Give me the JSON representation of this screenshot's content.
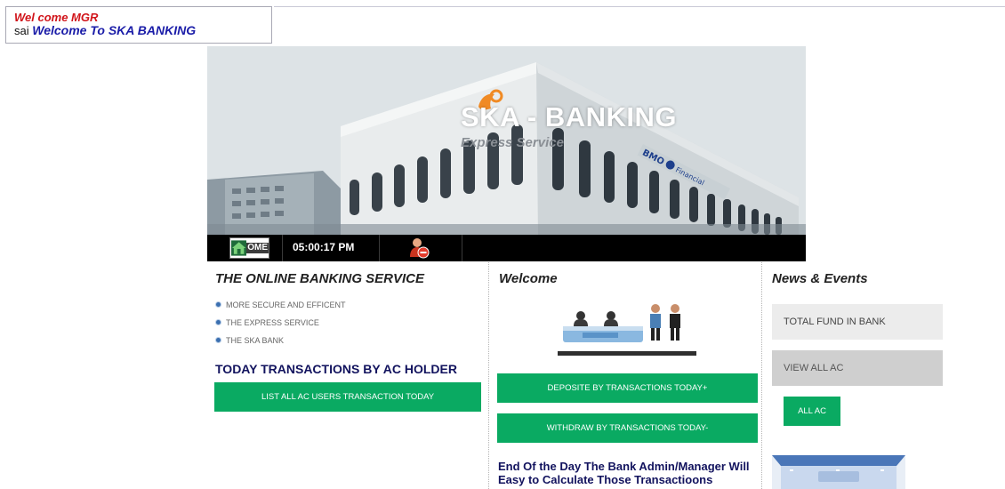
{
  "header": {
    "welcome_role": "Wel come MGR",
    "user_name": "sai",
    "welcome_message": "Welcome To SKA BANKING"
  },
  "banner": {
    "title": "SKA - BANKING",
    "subtitle": "Express Service"
  },
  "navbar": {
    "home_label": "OME",
    "clock": "05:00:17 PM",
    "home_icon": "home-icon",
    "logout_icon": "user-logout-icon"
  },
  "left": {
    "heading": "THE ONLINE BANKING SERVICE",
    "bullets": [
      "MORE SECURE AND EFFICENT",
      "THE EXPRESS SERVICE",
      "THE SKA BANK"
    ],
    "today_heading": "TODAY TRANSACTIONS BY AC HOLDER",
    "list_button": "LIST ALL AC USERS TRANSACTION TODAY"
  },
  "middle": {
    "heading": "Welcome",
    "deposit_button": "DEPOSITE BY TRANSACTIONS TODAY+",
    "withdraw_button": "WITHDRAW BY TRANSACTIONS TODAY-",
    "end_of_day_text": "End Of the Day The Bank Admin/Manager Will Easy to Calculate Those Transactioons"
  },
  "right": {
    "heading": "News & Events",
    "total_fund": "TOTAL FUND IN BANK",
    "view_all": "VIEW ALL AC",
    "all_ac_button": "ALL AC"
  },
  "colors": {
    "green": "#0aaa62",
    "navy": "#12135e",
    "red": "#d1141a",
    "blue": "#1a1ca8"
  }
}
